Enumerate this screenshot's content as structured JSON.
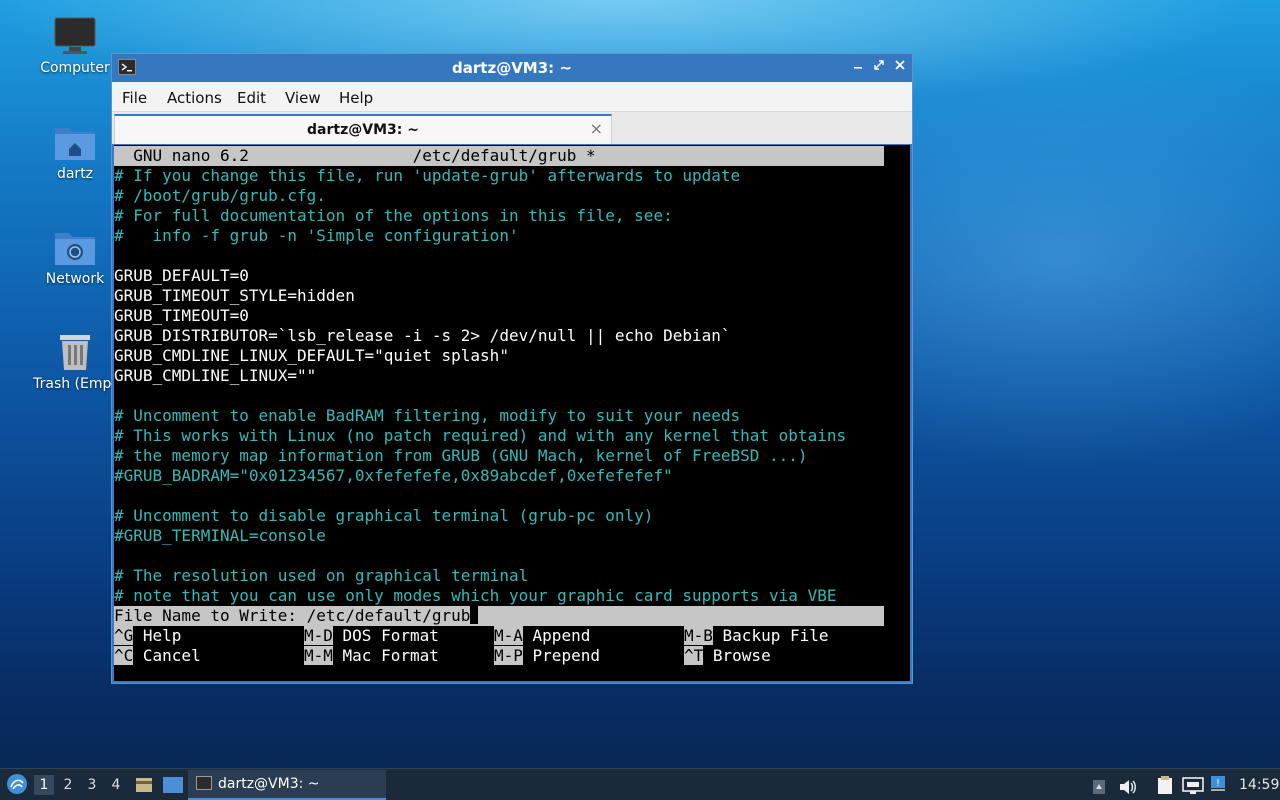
{
  "desktop": {
    "icons": [
      {
        "label": "Computer",
        "icon": "computer-icon"
      },
      {
        "label": "dartz",
        "icon": "home-folder-icon"
      },
      {
        "label": "Network",
        "icon": "network-folder-icon"
      },
      {
        "label": "Trash (Empt",
        "icon": "trash-icon"
      }
    ]
  },
  "window": {
    "title": "dartz@VM3: ~",
    "menu": [
      "File",
      "Actions",
      "Edit",
      "View",
      "Help"
    ],
    "tab_label": "dartz@VM3: ~"
  },
  "nano": {
    "header": "  GNU nano 6.2                 /etc/default/grub *",
    "lines": [
      "# If you change this file, run 'update-grub' afterwards to update",
      "# /boot/grub/grub.cfg.",
      "# For full documentation of the options in this file, see:",
      "#   info -f grub -n 'Simple configuration'",
      "",
      "GRUB_DEFAULT=0",
      "GRUB_TIMEOUT_STYLE=hidden",
      "GRUB_TIMEOUT=0",
      "GRUB_DISTRIBUTOR=`lsb_release -i -s 2> /dev/null || echo Debian`",
      "GRUB_CMDLINE_LINUX_DEFAULT=\"quiet splash\"",
      "GRUB_CMDLINE_LINUX=\"\"",
      "",
      "# Uncomment to enable BadRAM filtering, modify to suit your needs",
      "# This works with Linux (no patch required) and with any kernel that obtains",
      "# the memory map information from GRUB (GNU Mach, kernel of FreeBSD ...)",
      "#GRUB_BADRAM=\"0x01234567,0xfefefefe,0x89abcdef,0xefefefef\"",
      "",
      "# Uncomment to disable graphical terminal (grub-pc only)",
      "#GRUB_TERMINAL=console",
      "",
      "# The resolution used on graphical terminal",
      "# note that you can use only modes which your graphic card supports via VBE"
    ],
    "prompt": "File Name to Write: /etc/default/grub",
    "shortcuts_row1": [
      {
        "key": "^G",
        "label": " Help"
      },
      {
        "key": "M-D",
        "label": " DOS Format"
      },
      {
        "key": "M-A",
        "label": " Append"
      },
      {
        "key": "M-B",
        "label": " Backup File"
      }
    ],
    "shortcuts_row2": [
      {
        "key": "^C",
        "label": " Cancel"
      },
      {
        "key": "M-M",
        "label": " Mac Format"
      },
      {
        "key": "M-P",
        "label": " Prepend"
      },
      {
        "key": "^T",
        "label": " Browse"
      }
    ]
  },
  "taskbar": {
    "workspaces": [
      "1",
      "2",
      "3",
      "4"
    ],
    "task_label": "dartz@VM3: ~",
    "clock": "14:59"
  }
}
